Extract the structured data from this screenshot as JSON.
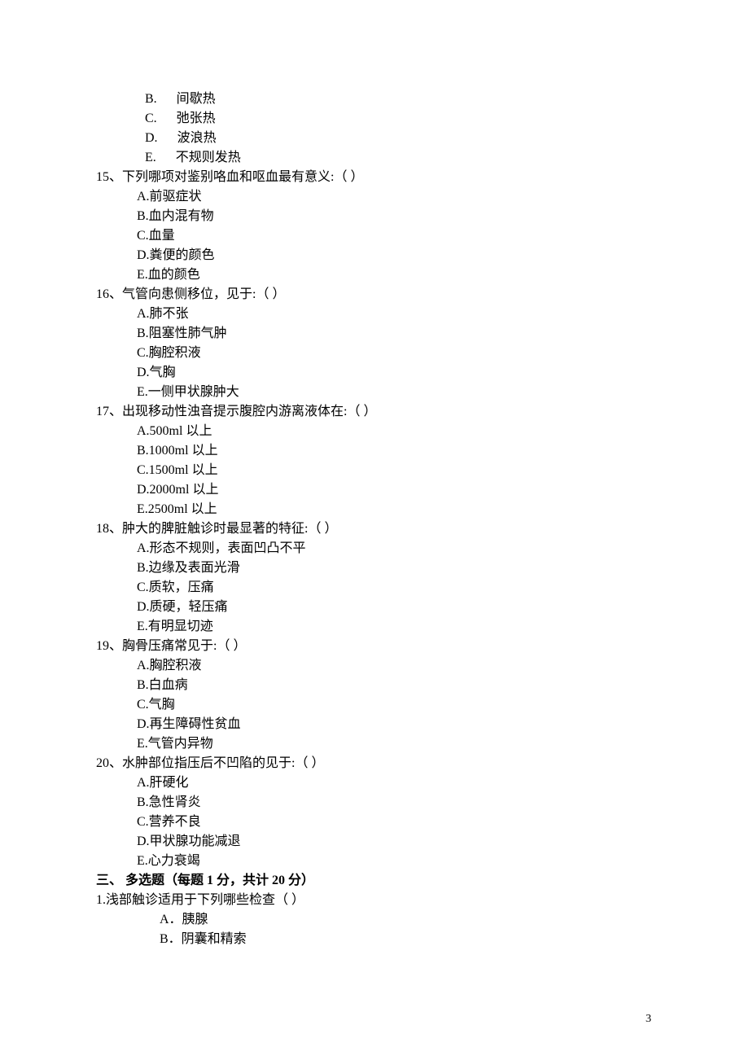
{
  "q14_options": {
    "B": "间歇热",
    "C": "弛张热",
    "D": "波浪热",
    "E": "不规则发热"
  },
  "q15": {
    "stem": "15、下列哪项对鉴别咯血和呕血最有意义:（  ）",
    "options": {
      "A": "A.前驱症状",
      "B": "B.血内混有物",
      "C": "C.血量",
      "D": "D.粪便的颜色",
      "E": "E.血的颜色"
    }
  },
  "q16": {
    "stem": "16、气管向患侧移位，见于:（  ）",
    "options": {
      "A": "A.肺不张",
      "B": "B.阻塞性肺气肿",
      "C": "C.胸腔积液",
      "D": "D.气胸",
      "E": "E.一侧甲状腺肿大"
    }
  },
  "q17": {
    "stem": "17、出现移动性浊音提示腹腔内游离液体在:（  ）",
    "options": {
      "A": "A.500ml 以上",
      "B": "B.1000ml 以上",
      "C": "C.1500ml 以上",
      "D": "D.2000ml 以上",
      "E": "E.2500ml 以上"
    }
  },
  "q18": {
    "stem": "18、肿大的脾脏触诊时最显著的特征:（   ）",
    "options": {
      "A": "A.形态不规则，表面凹凸不平",
      "B": "B.边缘及表面光滑",
      "C": "C.质软，压痛",
      "D": "D.质硬，轻压痛",
      "E": "E.有明显切迹"
    }
  },
  "q19": {
    "stem": "19、胸骨压痛常见于:（  ）",
    "options": {
      "A": "A.胸腔积液",
      "B": "B.白血病",
      "C": "C.气胸",
      "D": "D.再生障碍性贫血",
      "E": "E.气管内异物"
    }
  },
  "q20": {
    "stem": "20、水肿部位指压后不凹陷的见于:（   ）",
    "options": {
      "A": "A.肝硬化",
      "B": "B.急性肾炎",
      "C": "C.营养不良",
      "D": "D.甲状腺功能减退",
      "E": "E.心力衰竭"
    }
  },
  "section3": {
    "heading": "三、    多选题（每题 1 分，共计 20 分）"
  },
  "mq1": {
    "stem": "1.浅部触诊适用于下列哪些检查（   ）",
    "options": {
      "A": "A．胰腺",
      "B": "B．阴囊和精索"
    }
  },
  "page_number": "3"
}
